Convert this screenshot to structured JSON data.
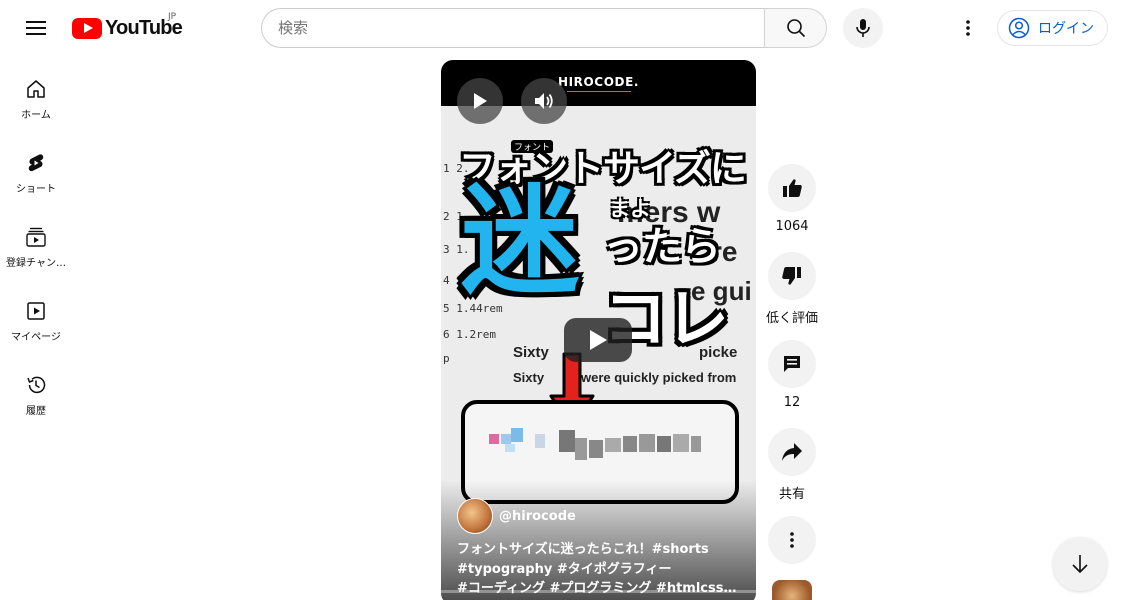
{
  "header": {
    "logo_text": "YouTube",
    "region": "JP",
    "search_placeholder": "検索",
    "login_label": "ログイン"
  },
  "sidebar": {
    "items": [
      {
        "label": "ホーム",
        "icon": "home-icon"
      },
      {
        "label": "ショート",
        "icon": "shorts-icon"
      },
      {
        "label": "登録チャン…",
        "icon": "subscriptions-icon"
      },
      {
        "label": "マイページ",
        "icon": "library-icon"
      },
      {
        "label": "履歴",
        "icon": "history-icon"
      }
    ]
  },
  "video": {
    "brand": "HIROCODE.",
    "thumbnail_text": {
      "line1": "フォントサイズに",
      "ruby": "フォント",
      "big_char": "迷",
      "small_mayo": "まよ",
      "line3": "ったら",
      "line4": "コレ",
      "bg_text_1": "mers w",
      "bg_text_2": "re",
      "bg_text_3": "e gui",
      "bg_text_4": "Sixty",
      "bg_text_5": "picke",
      "bg_text_6": "Sixty",
      "bg_text_7": "were quickly picked from",
      "code_lines": [
        "1  2.",
        "2  1.",
        "3  1.",
        "4  1.7rem",
        "5   1.44rem",
        "6   1.2rem",
        "p"
      ]
    },
    "channel": "@hirocode",
    "description_line1": "フォントサイズに迷ったらこれ！#shorts",
    "description_line2": "#typography #タイポグラフィー",
    "description_line3": "#コーディング #プログラミング #htmlcss…"
  },
  "actions": {
    "like_count": "1064",
    "dislike_label": "低く評価",
    "comment_count": "12",
    "share_label": "共有"
  },
  "colors": {
    "brand_red": "#ff0000",
    "link_blue": "#065fd4",
    "kanji_blue": "#21b4ef",
    "arrow_red": "#e5211c"
  }
}
